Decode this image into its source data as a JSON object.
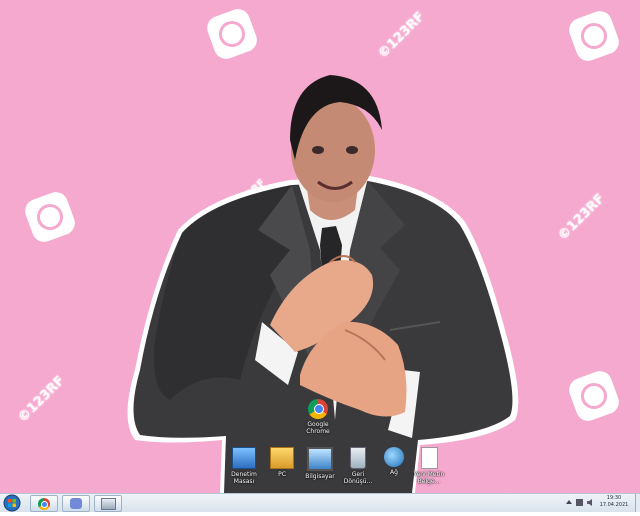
{
  "desktop": {
    "background_color": "#f6a9cf",
    "watermark_text": "©123RF",
    "icons": [
      {
        "name": "denetim-masasi",
        "label_line1": "Denetim",
        "label_line2": "Masası",
        "icon": "control-panel-icon"
      },
      {
        "name": "pc",
        "label_line1": "PC",
        "label_line2": "",
        "icon": "folder-pc-icon"
      },
      {
        "name": "bilgisayar",
        "label_line1": "Bilgisayar",
        "label_line2": "",
        "icon": "computer-icon"
      },
      {
        "name": "geri-donusum",
        "label_line1": "Geri",
        "label_line2": "Dönüşü...",
        "icon": "recycle-bin-icon"
      },
      {
        "name": "ag",
        "label_line1": "Ağ",
        "label_line2": "",
        "icon": "network-icon"
      },
      {
        "name": "yeni-metin-belgesi",
        "label_line1": "Yeni Metin",
        "label_line2": "Belge...",
        "icon": "text-document-icon"
      },
      {
        "name": "google-chrome",
        "label_line1": "Google",
        "label_line2": "Chrome",
        "icon": "chrome-icon"
      }
    ]
  },
  "taskbar": {
    "buttons": [
      {
        "name": "start-button",
        "icon": "windows-orb-icon"
      },
      {
        "name": "taskbar-chrome",
        "icon": "chrome-icon"
      },
      {
        "name": "taskbar-discord",
        "icon": "discord-icon"
      },
      {
        "name": "taskbar-window",
        "icon": "window-icon"
      }
    ],
    "clock_time": "19:30",
    "clock_date": "17.04.2021"
  }
}
